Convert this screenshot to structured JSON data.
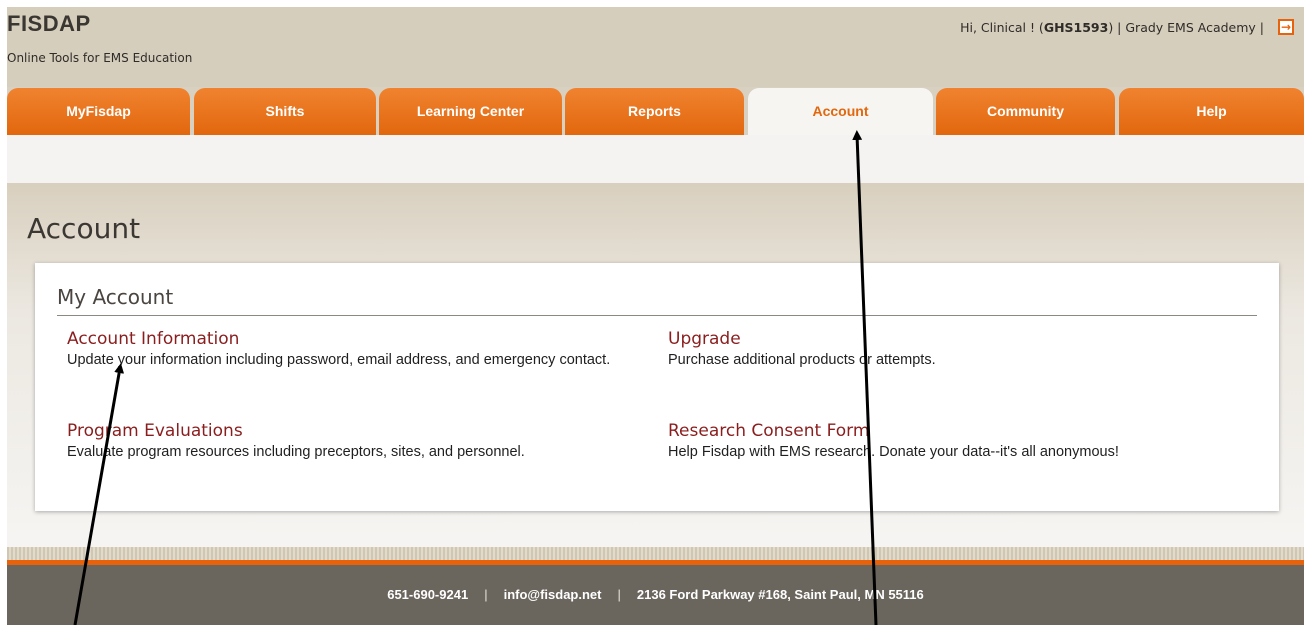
{
  "header": {
    "logo": "FISDAP",
    "tagline": "Online Tools for EMS Education",
    "greeting_prefix": "Hi, Clinical ! (",
    "user_id": "GHS1593",
    "greeting_suffix": ") | Grady EMS Academy |",
    "logout_icon": "logout-icon"
  },
  "tabs": [
    {
      "label": "MyFisdap"
    },
    {
      "label": "Shifts"
    },
    {
      "label": "Learning Center"
    },
    {
      "label": "Reports"
    },
    {
      "label": "Account",
      "active": true
    },
    {
      "label": "Community"
    },
    {
      "label": "Help"
    }
  ],
  "page_title": "Account",
  "section": {
    "title": "My Account",
    "items": [
      {
        "link": "Account Information",
        "desc": "Update your information including password, email address, and emergency contact."
      },
      {
        "link": "Upgrade",
        "desc": "Purchase additional products or attempts."
      },
      {
        "link": "Program Evaluations",
        "desc": "Evaluate program resources including preceptors, sites, and personnel."
      },
      {
        "link": "Research Consent Form",
        "desc": "Help Fisdap with EMS research. Donate your data--it's all anonymous!"
      }
    ]
  },
  "footer": {
    "phone": "651-690-9241",
    "email": "info@fisdap.net",
    "address": "2136 Ford Parkway #168, Saint Paul, MN 55116",
    "separator": "|"
  },
  "colors": {
    "tab_orange": "#e2670d",
    "link_red": "#8a1e1e",
    "footer_bg": "#6a655d"
  }
}
